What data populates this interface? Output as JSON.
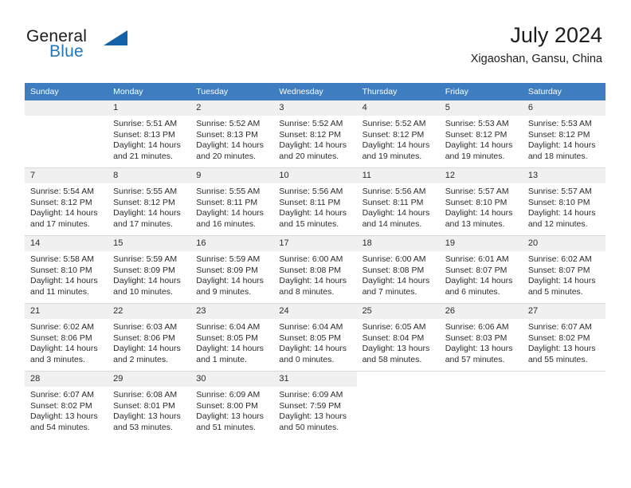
{
  "brand": {
    "name_part1": "General",
    "name_part2": "Blue",
    "logo_icon": "triangle-logo-icon"
  },
  "header": {
    "title": "July 2024",
    "location": "Xigaoshan, Gansu, China"
  },
  "colors": {
    "header_row_bg": "#3d7dc0",
    "header_row_text": "#ffffff",
    "daynum_bg": "#f0f0f0",
    "brand_blue": "#1f77be",
    "logo_blue": "#1362a8",
    "row_divider": "#d9d9d9",
    "body_text": "#2b2b2b"
  },
  "weekday_headers": [
    "Sunday",
    "Monday",
    "Tuesday",
    "Wednesday",
    "Thursday",
    "Friday",
    "Saturday"
  ],
  "labels": {
    "sunrise_prefix": "Sunrise:",
    "sunset_prefix": "Sunset:",
    "daylight_prefix": "Daylight:"
  },
  "weeks": [
    [
      {
        "day": "",
        "empty": true,
        "line1": "",
        "line2": "",
        "line3": "",
        "line4": ""
      },
      {
        "day": "1",
        "line1": "Sunrise: 5:51 AM",
        "line2": "Sunset: 8:13 PM",
        "line3": "Daylight: 14 hours",
        "line4": "and 21 minutes."
      },
      {
        "day": "2",
        "line1": "Sunrise: 5:52 AM",
        "line2": "Sunset: 8:13 PM",
        "line3": "Daylight: 14 hours",
        "line4": "and 20 minutes."
      },
      {
        "day": "3",
        "line1": "Sunrise: 5:52 AM",
        "line2": "Sunset: 8:12 PM",
        "line3": "Daylight: 14 hours",
        "line4": "and 20 minutes."
      },
      {
        "day": "4",
        "line1": "Sunrise: 5:52 AM",
        "line2": "Sunset: 8:12 PM",
        "line3": "Daylight: 14 hours",
        "line4": "and 19 minutes."
      },
      {
        "day": "5",
        "line1": "Sunrise: 5:53 AM",
        "line2": "Sunset: 8:12 PM",
        "line3": "Daylight: 14 hours",
        "line4": "and 19 minutes."
      },
      {
        "day": "6",
        "line1": "Sunrise: 5:53 AM",
        "line2": "Sunset: 8:12 PM",
        "line3": "Daylight: 14 hours",
        "line4": "and 18 minutes."
      }
    ],
    [
      {
        "day": "7",
        "line1": "Sunrise: 5:54 AM",
        "line2": "Sunset: 8:12 PM",
        "line3": "Daylight: 14 hours",
        "line4": "and 17 minutes."
      },
      {
        "day": "8",
        "line1": "Sunrise: 5:55 AM",
        "line2": "Sunset: 8:12 PM",
        "line3": "Daylight: 14 hours",
        "line4": "and 17 minutes."
      },
      {
        "day": "9",
        "line1": "Sunrise: 5:55 AM",
        "line2": "Sunset: 8:11 PM",
        "line3": "Daylight: 14 hours",
        "line4": "and 16 minutes."
      },
      {
        "day": "10",
        "line1": "Sunrise: 5:56 AM",
        "line2": "Sunset: 8:11 PM",
        "line3": "Daylight: 14 hours",
        "line4": "and 15 minutes."
      },
      {
        "day": "11",
        "line1": "Sunrise: 5:56 AM",
        "line2": "Sunset: 8:11 PM",
        "line3": "Daylight: 14 hours",
        "line4": "and 14 minutes."
      },
      {
        "day": "12",
        "line1": "Sunrise: 5:57 AM",
        "line2": "Sunset: 8:10 PM",
        "line3": "Daylight: 14 hours",
        "line4": "and 13 minutes."
      },
      {
        "day": "13",
        "line1": "Sunrise: 5:57 AM",
        "line2": "Sunset: 8:10 PM",
        "line3": "Daylight: 14 hours",
        "line4": "and 12 minutes."
      }
    ],
    [
      {
        "day": "14",
        "line1": "Sunrise: 5:58 AM",
        "line2": "Sunset: 8:10 PM",
        "line3": "Daylight: 14 hours",
        "line4": "and 11 minutes."
      },
      {
        "day": "15",
        "line1": "Sunrise: 5:59 AM",
        "line2": "Sunset: 8:09 PM",
        "line3": "Daylight: 14 hours",
        "line4": "and 10 minutes."
      },
      {
        "day": "16",
        "line1": "Sunrise: 5:59 AM",
        "line2": "Sunset: 8:09 PM",
        "line3": "Daylight: 14 hours",
        "line4": "and 9 minutes."
      },
      {
        "day": "17",
        "line1": "Sunrise: 6:00 AM",
        "line2": "Sunset: 8:08 PM",
        "line3": "Daylight: 14 hours",
        "line4": "and 8 minutes."
      },
      {
        "day": "18",
        "line1": "Sunrise: 6:00 AM",
        "line2": "Sunset: 8:08 PM",
        "line3": "Daylight: 14 hours",
        "line4": "and 7 minutes."
      },
      {
        "day": "19",
        "line1": "Sunrise: 6:01 AM",
        "line2": "Sunset: 8:07 PM",
        "line3": "Daylight: 14 hours",
        "line4": "and 6 minutes."
      },
      {
        "day": "20",
        "line1": "Sunrise: 6:02 AM",
        "line2": "Sunset: 8:07 PM",
        "line3": "Daylight: 14 hours",
        "line4": "and 5 minutes."
      }
    ],
    [
      {
        "day": "21",
        "line1": "Sunrise: 6:02 AM",
        "line2": "Sunset: 8:06 PM",
        "line3": "Daylight: 14 hours",
        "line4": "and 3 minutes."
      },
      {
        "day": "22",
        "line1": "Sunrise: 6:03 AM",
        "line2": "Sunset: 8:06 PM",
        "line3": "Daylight: 14 hours",
        "line4": "and 2 minutes."
      },
      {
        "day": "23",
        "line1": "Sunrise: 6:04 AM",
        "line2": "Sunset: 8:05 PM",
        "line3": "Daylight: 14 hours",
        "line4": "and 1 minute."
      },
      {
        "day": "24",
        "line1": "Sunrise: 6:04 AM",
        "line2": "Sunset: 8:05 PM",
        "line3": "Daylight: 14 hours",
        "line4": "and 0 minutes."
      },
      {
        "day": "25",
        "line1": "Sunrise: 6:05 AM",
        "line2": "Sunset: 8:04 PM",
        "line3": "Daylight: 13 hours",
        "line4": "and 58 minutes."
      },
      {
        "day": "26",
        "line1": "Sunrise: 6:06 AM",
        "line2": "Sunset: 8:03 PM",
        "line3": "Daylight: 13 hours",
        "line4": "and 57 minutes."
      },
      {
        "day": "27",
        "line1": "Sunrise: 6:07 AM",
        "line2": "Sunset: 8:02 PM",
        "line3": "Daylight: 13 hours",
        "line4": "and 55 minutes."
      }
    ],
    [
      {
        "day": "28",
        "line1": "Sunrise: 6:07 AM",
        "line2": "Sunset: 8:02 PM",
        "line3": "Daylight: 13 hours",
        "line4": "and 54 minutes."
      },
      {
        "day": "29",
        "line1": "Sunrise: 6:08 AM",
        "line2": "Sunset: 8:01 PM",
        "line3": "Daylight: 13 hours",
        "line4": "and 53 minutes."
      },
      {
        "day": "30",
        "line1": "Sunrise: 6:09 AM",
        "line2": "Sunset: 8:00 PM",
        "line3": "Daylight: 13 hours",
        "line4": "and 51 minutes."
      },
      {
        "day": "31",
        "line1": "Sunrise: 6:09 AM",
        "line2": "Sunset: 7:59 PM",
        "line3": "Daylight: 13 hours",
        "line4": "and 50 minutes."
      },
      {
        "day": "",
        "blank": true,
        "line1": "",
        "line2": "",
        "line3": "",
        "line4": ""
      },
      {
        "day": "",
        "blank": true,
        "line1": "",
        "line2": "",
        "line3": "",
        "line4": ""
      },
      {
        "day": "",
        "blank": true,
        "line1": "",
        "line2": "",
        "line3": "",
        "line4": ""
      }
    ]
  ]
}
